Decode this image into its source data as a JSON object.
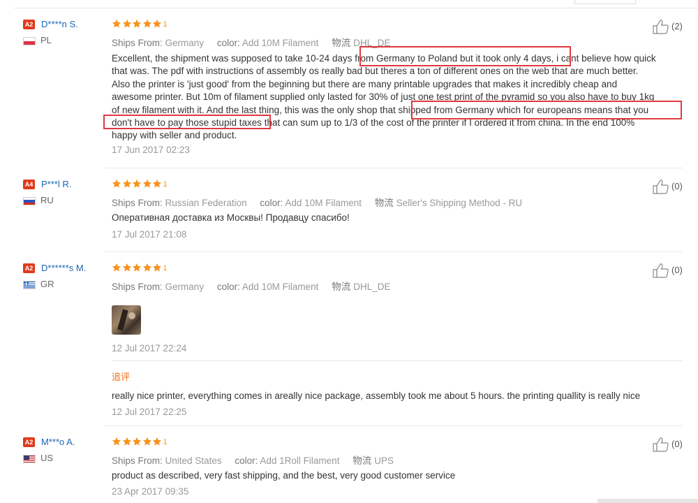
{
  "reviews": [
    {
      "badge": "A2",
      "name": "D****n S.",
      "country": "PL",
      "rank_label": "1",
      "ships_from_label": "Ships From:",
      "ships_from": "Germany",
      "color_label": "color:",
      "color": "Add 10M Filament",
      "logistics_label": "物流",
      "logistics": "DHL_DE",
      "likes": "(2)",
      "text_lines": [
        "Excellent, the shipment was supposed to take 10-24 days from Germany to Poland but it took only 4 days, i cant believe how quick",
        "that was. The pdf with instructions of assembly os really bad but theres a ton of different ones on the web that are much better.",
        "Also the printer is 'just good' from the beginning but there are many printable upgrades that makes it incredibly cheap and",
        "awesome printer. But 10m of filament supplied only lasted for 30% of just one test print of the pyramid so you also have to buy 1kg",
        "of new filament with it. And the last thing, this was the only shop that shipped from Germany which for europeans means that you",
        "don't have to pay those stupid taxes that can sum up to 1/3 of the cost of the printer if I ordered it from china. In the end 100%",
        "happy with seller and product."
      ],
      "date": "17 Jun 2017 02:23"
    },
    {
      "badge": "A4",
      "name": "P***l R.",
      "country": "RU",
      "rank_label": "1",
      "ships_from_label": "Ships From:",
      "ships_from": "Russian Federation",
      "color_label": "color:",
      "color": "Add 10M Filament",
      "logistics_label": "物流",
      "logistics": "Seller's Shipping Method - RU",
      "likes": "(0)",
      "text_lines": [
        "Оперативная доставка из Москвы! Продавцу спасибо!"
      ],
      "date": "17 Jul 2017 21:08"
    },
    {
      "badge": "A2",
      "name": "D******s M.",
      "country": "GR",
      "rank_label": "1",
      "ships_from_label": "Ships From:",
      "ships_from": "Germany",
      "color_label": "color:",
      "color": "Add 10M Filament",
      "logistics_label": "物流",
      "logistics": "DHL_DE",
      "likes": "(0)",
      "date": "12 Jul 2017 22:24",
      "followup_label": "追评",
      "followup_text": "really nice printer, everything comes in areally nice package, assembly took me about 5 hours. the printing quallity is really nice",
      "followup_date": "12 Jul 2017 22:25"
    },
    {
      "badge": "A2",
      "name": "M***o A.",
      "country": "US",
      "rank_label": "1",
      "ships_from_label": "Ships From:",
      "ships_from": "United States",
      "color_label": "color:",
      "color": "Add 1Roll Filament",
      "logistics_label": "物流",
      "logistics": "UPS",
      "likes": "(0)",
      "text_lines": [
        "product as described, very fast shipping, and the best, very good customer service"
      ],
      "date": "23 Apr 2017 09:35"
    }
  ],
  "colors": {
    "star": "#f7931e",
    "badge": "#e03a1c",
    "username": "#1a64b4",
    "highlight_box": "#e0393e",
    "followup_tag": "#f06b1a"
  }
}
